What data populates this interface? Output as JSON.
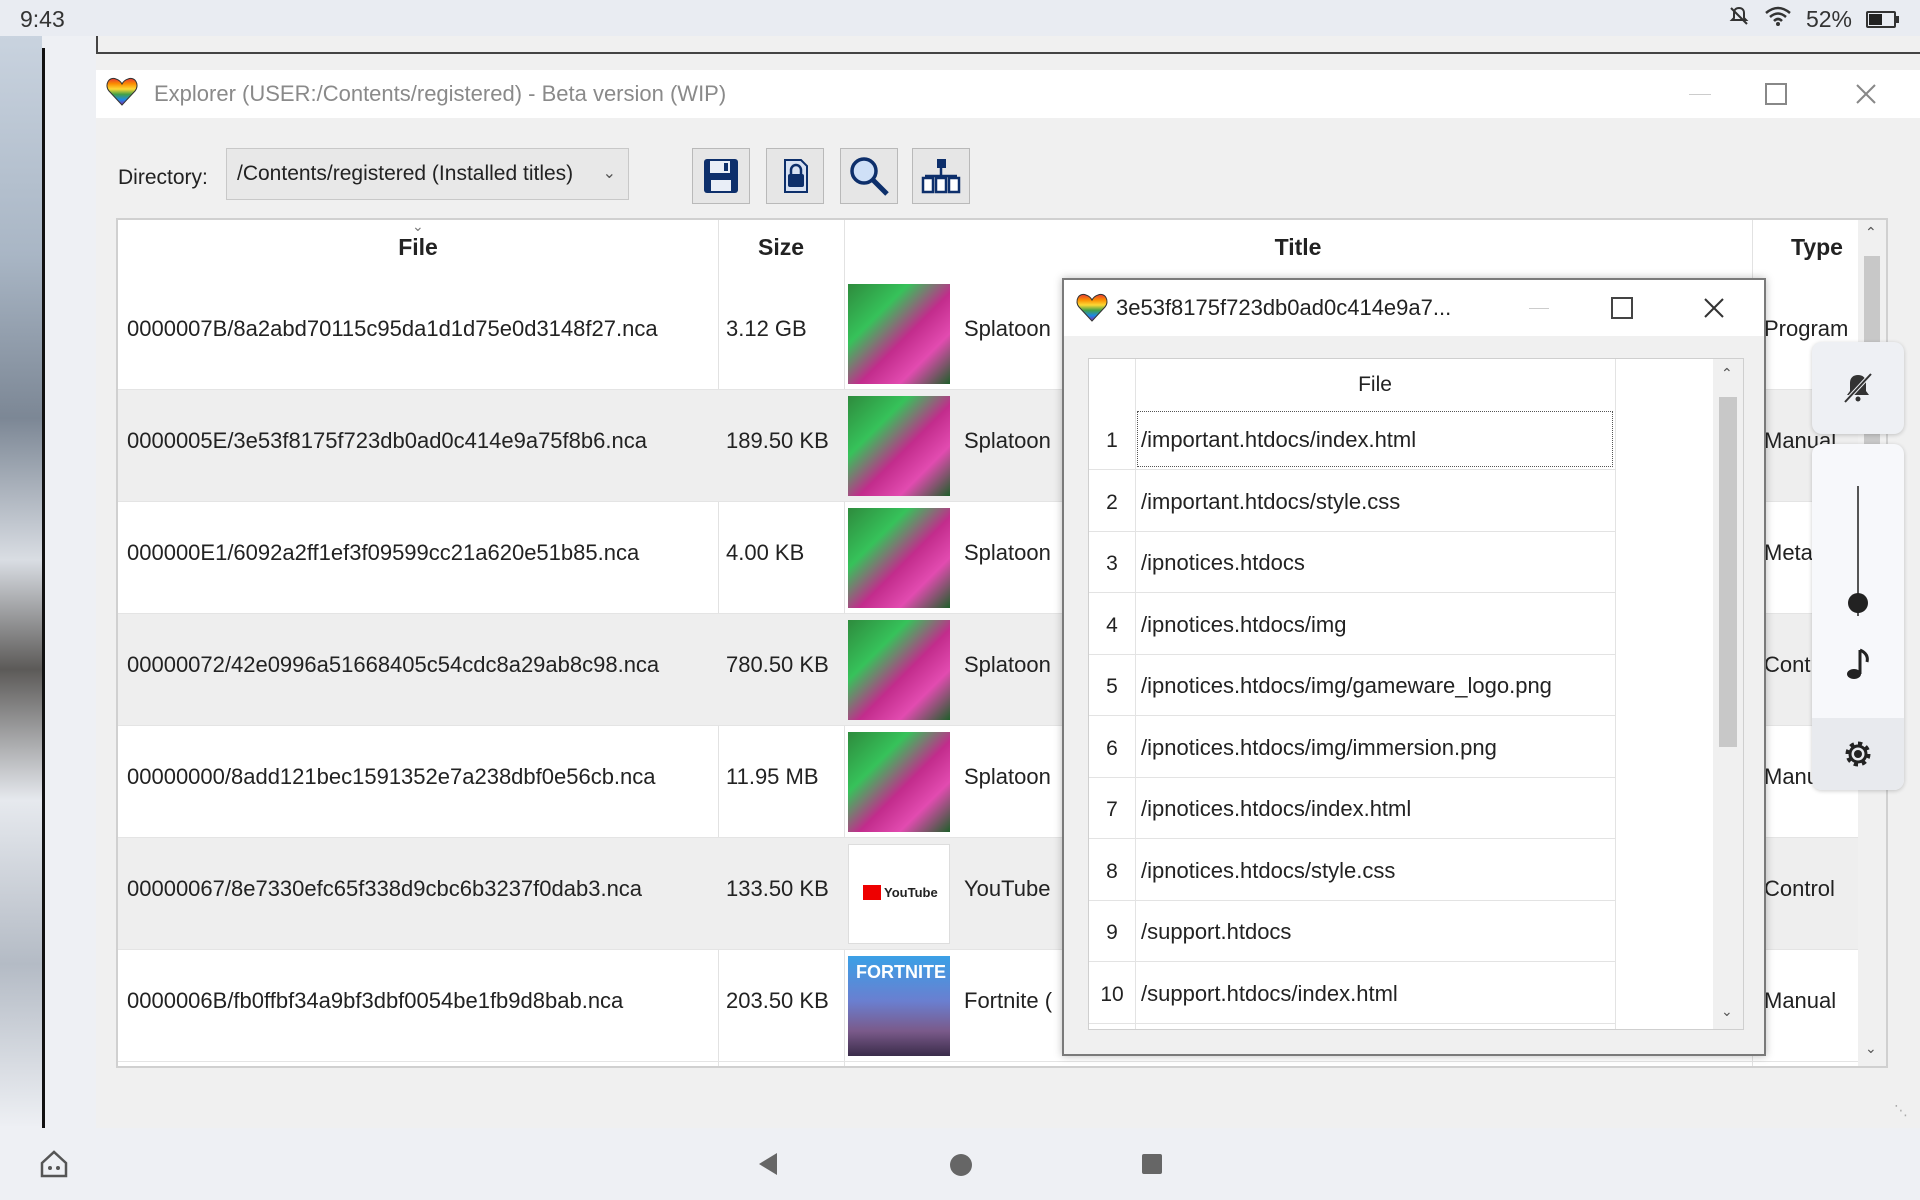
{
  "statusbar": {
    "time": "9:43",
    "battery": "52%"
  },
  "window": {
    "title": "Explorer (USER:/Contents/registered) - Beta version (WIP)",
    "minimize_icon": "minimize-icon",
    "maximize_icon": "maximize-icon",
    "close_icon": "close-icon"
  },
  "toolbar": {
    "directory_label": "Directory:",
    "directory_value": "/Contents/registered (Installed titles)",
    "buttons": [
      "save-icon",
      "lock-icon",
      "search-icon",
      "tree-icon"
    ]
  },
  "table": {
    "columns": [
      "File",
      "Size",
      "Title",
      "Type"
    ],
    "rows": [
      {
        "file": "0000007B/8a2abd70115c95da1d1d75e0d3148f27.nca",
        "size": "3.12 GB",
        "title": "Splatoon",
        "type": "Program",
        "thumb": "splatoon"
      },
      {
        "file": "0000005E/3e53f8175f723db0ad0c414e9a75f8b6.nca",
        "size": "189.50 KB",
        "title": "Splatoon",
        "type": "Manual",
        "thumb": "splatoon"
      },
      {
        "file": "000000E1/6092a2ff1ef3f09599cc21a620e51b85.nca",
        "size": "4.00 KB",
        "title": "Splatoon",
        "type": "Meta",
        "thumb": "splatoon"
      },
      {
        "file": "00000072/42e0996a51668405c54cdc8a29ab8c98.nca",
        "size": "780.50 KB",
        "title": "Splatoon",
        "type": "Control",
        "thumb": "splatoon"
      },
      {
        "file": "00000000/8add121bec1591352e7a238dbf0e56cb.nca",
        "size": "11.95 MB",
        "title": "Splatoon",
        "type": "Manual",
        "thumb": "splatoon"
      },
      {
        "file": "00000067/8e7330efc65f338d9cbc6b3237f0dab3.nca",
        "size": "133.50 KB",
        "title": "YouTube",
        "type": "Control",
        "thumb": "youtube"
      },
      {
        "file": "0000006B/fb0ffbf34a9bf3dbf0054be1fb9d8bab.nca",
        "size": "203.50 KB",
        "title": "Fortnite (",
        "type": "Manual",
        "thumb": "fortnite"
      }
    ],
    "thumb_labels": {
      "youtube": "YouTube",
      "fortnite": "FORTNITE"
    }
  },
  "dialog": {
    "title": "3e53f8175f723db0ad0c414e9a7...",
    "column": "File",
    "rows": [
      {
        "num": "1",
        "path": "/important.htdocs/index.html"
      },
      {
        "num": "2",
        "path": "/important.htdocs/style.css"
      },
      {
        "num": "3",
        "path": "/ipnotices.htdocs"
      },
      {
        "num": "4",
        "path": "/ipnotices.htdocs/img"
      },
      {
        "num": "5",
        "path": "/ipnotices.htdocs/img/gameware_logo.png"
      },
      {
        "num": "6",
        "path": "/ipnotices.htdocs/img/immersion.png"
      },
      {
        "num": "7",
        "path": "/ipnotices.htdocs/index.html"
      },
      {
        "num": "8",
        "path": "/ipnotices.htdocs/style.css"
      },
      {
        "num": "9",
        "path": "/support.htdocs"
      },
      {
        "num": "10",
        "path": "/support.htdocs/index.html"
      }
    ]
  },
  "volume_panel": {
    "level": 0.1,
    "icons": [
      "bell-off-icon",
      "music-note-icon",
      "gear-icon"
    ]
  },
  "navbar": {
    "icons": [
      "home-icon",
      "back-icon",
      "home-circle-icon",
      "recents-icon"
    ]
  }
}
